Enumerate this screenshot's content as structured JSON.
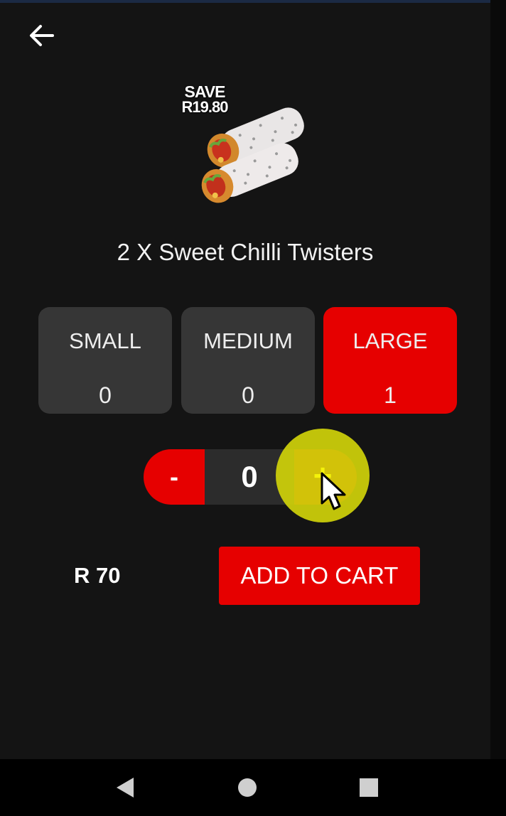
{
  "product": {
    "title": "2 X Sweet Chilli Twisters",
    "badge": {
      "line1": "SAVE",
      "line2": "R19.80"
    },
    "image_icon": "wrap-image"
  },
  "sizes": [
    {
      "label": "SMALL",
      "count": "0",
      "selected": false
    },
    {
      "label": "MEDIUM",
      "count": "0",
      "selected": false
    },
    {
      "label": "LARGE",
      "count": "1",
      "selected": true
    }
  ],
  "stepper": {
    "decrement_label": "-",
    "value": "0",
    "increment_label": "+"
  },
  "footer": {
    "price": "R 70",
    "add_to_cart_label": "ADD TO CART"
  },
  "navigation": {
    "back_icon": "arrow-left-icon",
    "nav_icons": [
      "back-triangle-icon",
      "home-circle-icon",
      "recents-square-icon"
    ]
  },
  "colors": {
    "accent": "#e60000",
    "background": "#141414",
    "option_bg": "#363636",
    "touch_highlight": "#d0d20a"
  }
}
